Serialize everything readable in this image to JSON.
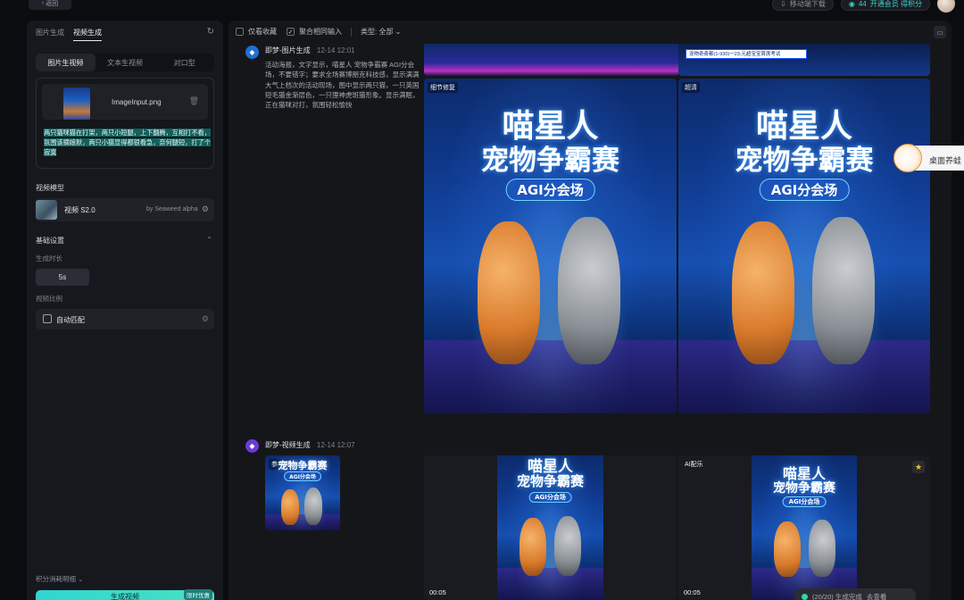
{
  "topbar": {
    "back_label": "返回",
    "download_label": "移动端下载",
    "points_value": "44",
    "member_label": "开通会员 得积分"
  },
  "left_panel": {
    "mode_tabs": [
      "图片生成",
      "视频生成"
    ],
    "active_mode": "视频生成",
    "sub_tabs": [
      "图片生视频",
      "文本生视频",
      "对口型"
    ],
    "active_sub_tab": "图片生视频",
    "upload": {
      "file_name": "ImageInput.png",
      "prompt": "两只猫咪猫在打架，两只小短腿，上下翻腾，互相打不看，氛围该摘娘默，两只小猫显得都很看急，奈何腿短，打了个寂寞"
    },
    "model": {
      "section_label": "视频模型",
      "name": "视频 S2.0",
      "by": "by Seaweed alpha"
    },
    "basic": {
      "section_label": "基础设置",
      "duration_label": "生成时长",
      "duration_value": "5s",
      "ratio_label": "视频比例",
      "ratio_value": "自动匹配"
    },
    "points_detail": "积分消耗明细",
    "generate": {
      "label": "生成视频",
      "badge": "限时优惠"
    }
  },
  "right_panel": {
    "filters": {
      "favorites": "仅看收藏",
      "aggregate": "聚合相同输入",
      "type": "类型: 全部"
    },
    "msg1": {
      "title": "即梦-图片生成",
      "time": "12-14  12:01",
      "body": "活动海报，文字显示，喵星人 宠物争霸赛 AGI分会场，不要错字；要求全场赛博朋克科技感，显示满满大气上档次的活动现场，图中显示两只猫，一只英国短毛猫金渐层色，一只狸神虎斑猫形象。显示满眠，正在猫咪对打，氛围轻松愉快",
      "img_tag_1": "细节修复",
      "img_tag_2": "超清",
      "strip_text": "宠物奇奇都(1-930)一23;元超宝宝首席考试"
    },
    "poster": {
      "title_line1": "喵星人",
      "title_line2": "宠物争霸赛",
      "subtitle": "AGI分会场"
    },
    "msg2": {
      "title": "即梦-视频生成",
      "time": "12-14  12:07",
      "ref_tag": "参考图",
      "ai_tag": "AI配乐",
      "duration_1": "00:05",
      "duration_2": "00:05"
    },
    "status": "(20/20) 生成完成",
    "status_more": "去查看"
  },
  "pet_widget": {
    "label": "桌面养蛙"
  }
}
